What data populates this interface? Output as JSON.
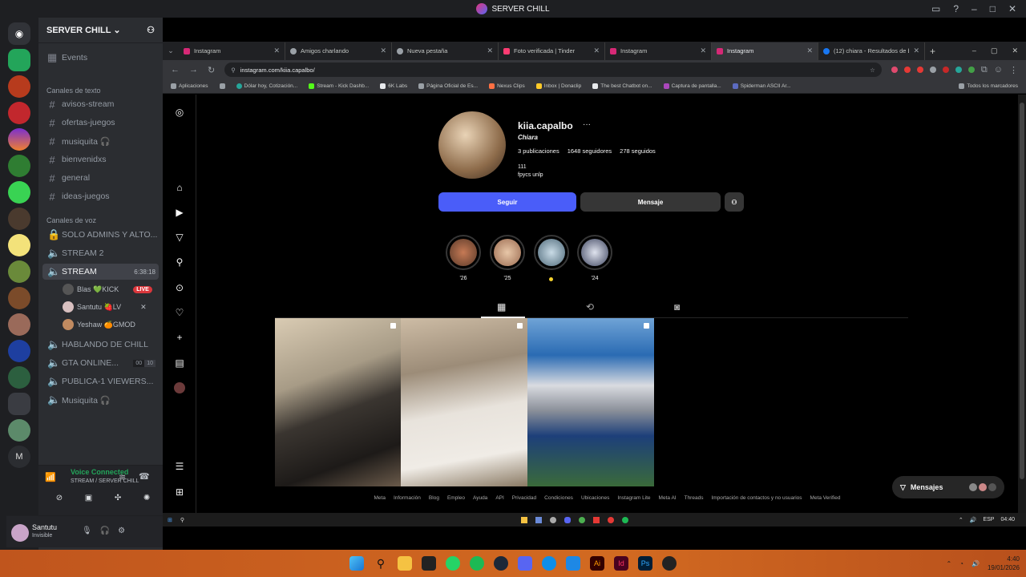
{
  "window": {
    "title": "SERVER CHILL"
  },
  "sidebar": {
    "server_name": "SERVER CHILL",
    "events": "Events",
    "text_category": "Canales de texto",
    "text_channels": [
      "avisos-stream",
      "ofertas-juegos",
      "musiquita 🎧",
      "bienvenidxs",
      "general",
      "ideas-juegos"
    ],
    "voice_category": "Canales de voz",
    "voice_channels": [
      "SOLO ADMINS Y ALTO...",
      "STREAM 2",
      "STREAM",
      "HABLANDO DE CHILL",
      "GTA ONLINE...",
      "PUBLICA-1 VIEWERS...",
      "Musiquita 🎧"
    ],
    "stream_timer": "6:38:18",
    "stream_users": [
      {
        "name": "Blas 💚KICK",
        "badge": "LIVE"
      },
      {
        "name": "Santutu 🍓LV"
      },
      {
        "name": "Yeshaw 🍊GMOD"
      }
    ],
    "gta_counts": [
      "00",
      "10"
    ]
  },
  "voice": {
    "status": "Voice Connected",
    "location": "STREAM / SERVER CHILL"
  },
  "user": {
    "name": "Santutu",
    "status": "Invisible"
  },
  "browser": {
    "tabs": [
      "Instagram",
      "Amigos charlando",
      "Nueva pestaña",
      "Foto verificada | Tinder",
      "Instagram",
      "Instagram",
      "(12) chiara - Resultados de bús..."
    ],
    "url": "instagram.com/kiia.capalbo/",
    "bookmarks": [
      "Aplicaciones",
      "Dólar hoy, Cotización...",
      "Stream - Kick Dashb...",
      "6K Labs",
      "Página Oficial de Es...",
      "Nexus Clips",
      "Inbox | Donaclip",
      "The best Chatbot on...",
      "Captura de pantalla...",
      "Spiderman ASCII Ar..."
    ],
    "all_bookmarks": "Todos los marcadores"
  },
  "profile": {
    "username": "kiia.capalbo",
    "name": "Chiara",
    "posts": "3 publicaciones",
    "followers": "1648 seguidores",
    "following": "278 seguidos",
    "bio1": "111",
    "bio2": "fpycs unlp",
    "follow": "Seguir",
    "message": "Mensaje",
    "highlights": [
      "'26",
      "'25",
      "",
      "'24"
    ]
  },
  "footer": [
    "Meta",
    "Información",
    "Blog",
    "Empleo",
    "Ayuda",
    "API",
    "Privacidad",
    "Condiciones",
    "Ubicaciones",
    "Instagram Lite",
    "Meta AI",
    "Threads",
    "Importación de contactos y no usuarios",
    "Meta Verified"
  ],
  "messages_label": "Mensajes",
  "embedded_tray": {
    "lang": "ESP",
    "time": "04:40"
  },
  "taskbar": {
    "time": "4:40",
    "date": "19/01/2026"
  }
}
